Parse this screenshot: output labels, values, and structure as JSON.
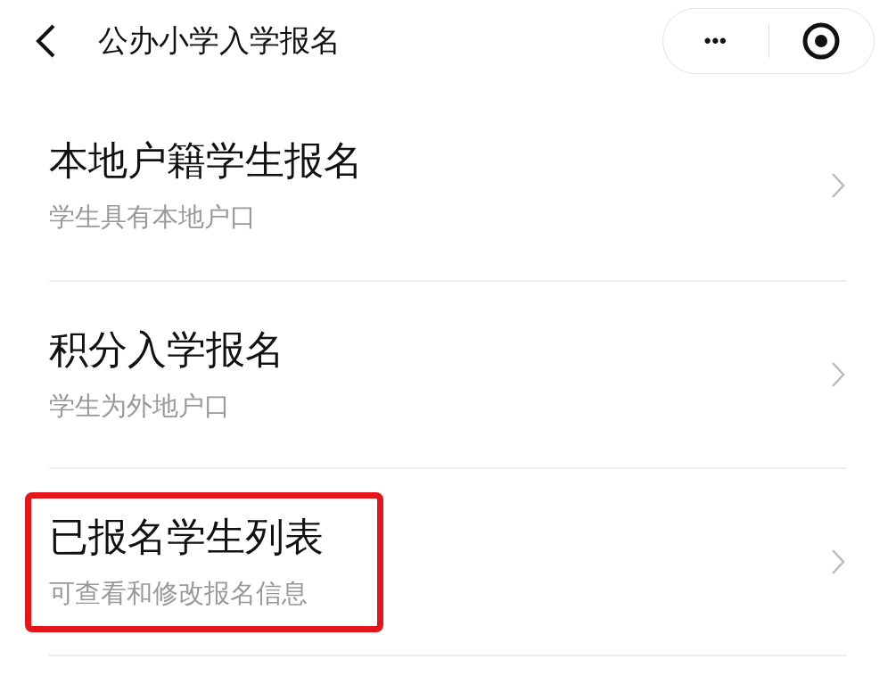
{
  "header": {
    "title": "公办小学入学报名",
    "menu": "•••"
  },
  "items": [
    {
      "title": "本地户籍学生报名",
      "subtitle": "学生具有本地户口",
      "highlighted": false
    },
    {
      "title": "积分入学报名",
      "subtitle": "学生为外地户口",
      "highlighted": false
    },
    {
      "title": "已报名学生列表",
      "subtitle": "可查看和修改报名信息",
      "highlighted": true
    }
  ]
}
